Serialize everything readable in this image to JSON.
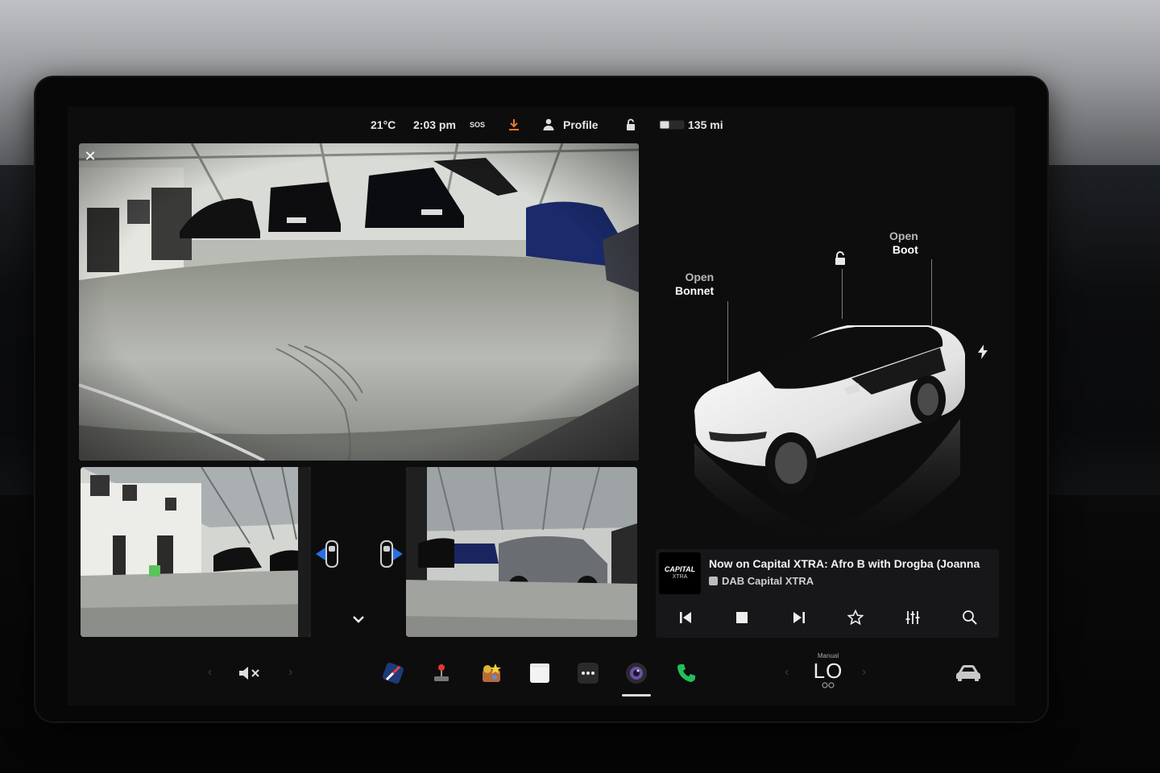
{
  "status_bar": {
    "temperature": "21°C",
    "time": "2:03 pm",
    "sos_label": "SOS",
    "profile_label": "Profile",
    "range": "135 mi",
    "icons": [
      "sos-icon",
      "download-icon",
      "person-icon",
      "unlock-icon",
      "battery-icon"
    ]
  },
  "camera_panel": {
    "close_icon": "close-icon",
    "views": [
      "rear-camera",
      "left-repeater-camera",
      "right-repeater-camera"
    ],
    "expand_icon": "chevron-down-icon"
  },
  "vehicle": {
    "bonnet_line1": "Open",
    "bonnet_line2": "Bonnet",
    "boot_line1": "Open",
    "boot_line2": "Boot",
    "icons": [
      "unlock-icon",
      "charge-port-icon"
    ]
  },
  "media": {
    "station_logo_text": "CAPITAL",
    "station_logo_sub": "XTRA",
    "now_playing": "Now on Capital XTRA: Afro B with Drogba (Joanna",
    "source": "DAB Capital XTRA",
    "controls": [
      "previous-icon",
      "stop-icon",
      "next-icon",
      "favorite-icon",
      "equalizer-icon",
      "search-icon"
    ]
  },
  "dock": {
    "climate_mode": "Manual",
    "climate_temp": "LO",
    "apps": [
      "navigation-icon",
      "arcade-icon",
      "toybox-icon",
      "notes-icon",
      "more-icon",
      "camera-icon",
      "phone-icon"
    ],
    "active_app": "camera-icon"
  },
  "colors": {
    "accent_orange": "#e8792b",
    "phone_green": "#21c05a",
    "camera_purple": "#6b4fa5",
    "blind_spot_blue": "#2a6fe0"
  }
}
